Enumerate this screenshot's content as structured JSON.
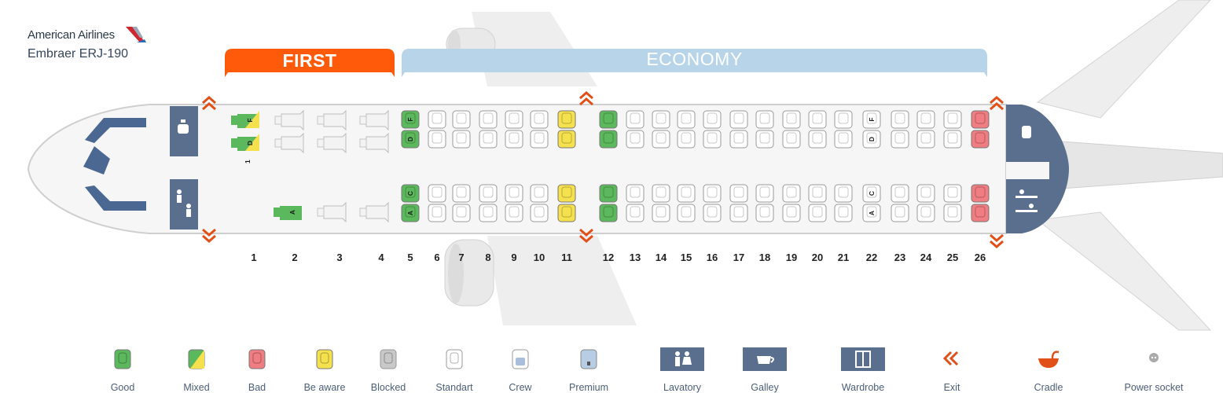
{
  "header": {
    "airline": "American Airlines",
    "aircraft": "Embraer ERJ-190"
  },
  "sections": {
    "first": "FIRST",
    "economy": "ECONOMY"
  },
  "rows": [
    "1",
    "2",
    "3",
    "4",
    "5",
    "6",
    "7",
    "8",
    "9",
    "10",
    "11",
    "12",
    "13",
    "14",
    "15",
    "16",
    "17",
    "18",
    "19",
    "20",
    "21",
    "22",
    "23",
    "24",
    "25",
    "26"
  ],
  "first_class_seats": [
    {
      "row": "1",
      "seat": "F",
      "status": "mixed"
    },
    {
      "row": "1",
      "seat": "D",
      "status": "mixed"
    },
    {
      "row": "2",
      "seat": "A",
      "status": "good"
    }
  ],
  "seat_markings": {
    "row5_right": [
      "F",
      "D"
    ],
    "row5_left": [
      "C",
      "A"
    ],
    "row22_right": [
      "F",
      "D"
    ],
    "row22_left": [
      "C",
      "A"
    ],
    "row1_small": "1"
  },
  "status_colors": {
    "good": "#5cb85c",
    "bad": "#ef7d82",
    "be_aware": "#f4e14d",
    "blocked": "#c8c8c8",
    "standard": "#ffffff",
    "first_band": "#ff5a0a",
    "economy_band": "#b7d4e8",
    "cabin_icon_bg": "#5a6f8d",
    "exit": "#e2501a"
  },
  "legend": [
    {
      "label": "Good",
      "icon": "good-seat-icon"
    },
    {
      "label": "Mixed",
      "icon": "mixed-seat-icon"
    },
    {
      "label": "Bad",
      "icon": "bad-seat-icon"
    },
    {
      "label": "Be aware",
      "icon": "be-aware-seat-icon"
    },
    {
      "label": "Blocked",
      "icon": "blocked-seat-icon"
    },
    {
      "label": "Standart",
      "icon": "standard-seat-icon"
    },
    {
      "label": "Crew",
      "icon": "crew-seat-icon"
    },
    {
      "label": "Premium",
      "icon": "premium-seat-icon"
    },
    {
      "label": "Lavatory",
      "icon": "lavatory-icon"
    },
    {
      "label": "Galley",
      "icon": "galley-icon"
    },
    {
      "label": "Wardrobe",
      "icon": "wardrobe-icon"
    },
    {
      "label": "Exit",
      "icon": "exit-icon"
    },
    {
      "label": "Cradle",
      "icon": "cradle-icon"
    },
    {
      "label": "Power socket",
      "icon": "power-socket-icon"
    }
  ]
}
